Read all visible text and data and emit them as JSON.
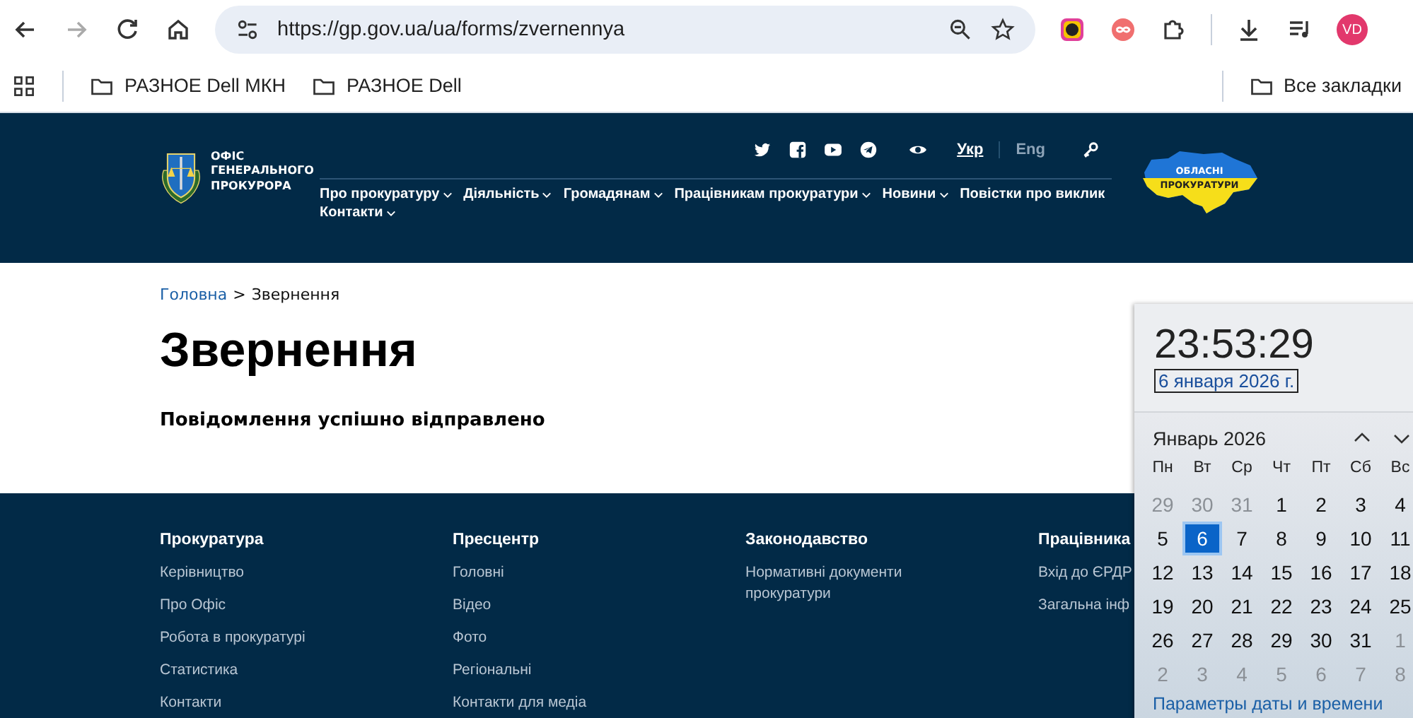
{
  "browser": {
    "url": "https://gp.gov.ua/ua/forms/zvernennya",
    "profile": "VD",
    "bookmarks": [
      {
        "label": "РАЗНОЕ Dell МКН"
      },
      {
        "label": "РАЗНОЕ Dell"
      }
    ],
    "all_bookmarks": "Все закладки"
  },
  "header": {
    "logo_text": "ОФІС ГЕНЕРАЛЬНОГО ПРОКУРОРА",
    "languages": [
      {
        "label": "Укр",
        "selected": true
      },
      {
        "label": "Eng",
        "selected": false
      }
    ],
    "nav": [
      {
        "label": "Про прокуратуру",
        "has_menu": true
      },
      {
        "label": "Діяльність",
        "has_menu": true
      },
      {
        "label": "Громадянам",
        "has_menu": true
      },
      {
        "label": "Працівникам прокуратури",
        "has_menu": true
      },
      {
        "label": "Новини",
        "has_menu": true
      },
      {
        "label": "Повістки про виклик",
        "has_menu": false
      },
      {
        "label": "Контакти",
        "has_menu": true
      }
    ],
    "map_badge": [
      "ОБЛАСНІ",
      "ПРОКУРАТУРИ"
    ]
  },
  "breadcrumb": [
    {
      "label": "Головна",
      "link": true
    },
    {
      "label": "Звернення",
      "link": false
    }
  ],
  "breadcrumb_separator": ">",
  "page": {
    "title": "Звернення",
    "message": "Повідомлення успішно відправлено"
  },
  "footer": [
    {
      "heading": "Прокуратура",
      "links": [
        "Керівництво",
        "Про Офіс",
        "Робота в прокуратурі",
        "Статистика",
        "Контакти"
      ]
    },
    {
      "heading": "Пресцентр",
      "links": [
        "Головні",
        "Відео",
        "Фото",
        "Регіональні",
        "Контакти для медіа"
      ]
    },
    {
      "heading": "Законодавство",
      "links": [
        "Нормативні документи прокуратури"
      ]
    },
    {
      "heading": "Працівника",
      "links": [
        "Вхід до ЄРДР",
        "Загальна інф"
      ]
    }
  ],
  "calendar": {
    "time": "23:53:29",
    "date": "6 января 2026 г.",
    "month": "Январь 2026",
    "weekdays": [
      "Пн",
      "Вт",
      "Ср",
      "Чт",
      "Пт",
      "Сб",
      "Вс"
    ],
    "days": [
      {
        "label": "29",
        "muted": true,
        "selected": false
      },
      {
        "label": "30",
        "muted": true,
        "selected": false
      },
      {
        "label": "31",
        "muted": true,
        "selected": false
      },
      {
        "label": "1",
        "muted": false,
        "selected": false
      },
      {
        "label": "2",
        "muted": false,
        "selected": false
      },
      {
        "label": "3",
        "muted": false,
        "selected": false
      },
      {
        "label": "4",
        "muted": false,
        "selected": false
      },
      {
        "label": "5",
        "muted": false,
        "selected": false
      },
      {
        "label": "6",
        "muted": false,
        "selected": true
      },
      {
        "label": "7",
        "muted": false,
        "selected": false
      },
      {
        "label": "8",
        "muted": false,
        "selected": false
      },
      {
        "label": "9",
        "muted": false,
        "selected": false
      },
      {
        "label": "10",
        "muted": false,
        "selected": false
      },
      {
        "label": "11",
        "muted": false,
        "selected": false
      },
      {
        "label": "12",
        "muted": false,
        "selected": false
      },
      {
        "label": "13",
        "muted": false,
        "selected": false
      },
      {
        "label": "14",
        "muted": false,
        "selected": false
      },
      {
        "label": "15",
        "muted": false,
        "selected": false
      },
      {
        "label": "16",
        "muted": false,
        "selected": false
      },
      {
        "label": "17",
        "muted": false,
        "selected": false
      },
      {
        "label": "18",
        "muted": false,
        "selected": false
      },
      {
        "label": "19",
        "muted": false,
        "selected": false
      },
      {
        "label": "20",
        "muted": false,
        "selected": false
      },
      {
        "label": "21",
        "muted": false,
        "selected": false
      },
      {
        "label": "22",
        "muted": false,
        "selected": false
      },
      {
        "label": "23",
        "muted": false,
        "selected": false
      },
      {
        "label": "24",
        "muted": false,
        "selected": false
      },
      {
        "label": "25",
        "muted": false,
        "selected": false
      },
      {
        "label": "26",
        "muted": false,
        "selected": false
      },
      {
        "label": "27",
        "muted": false,
        "selected": false
      },
      {
        "label": "28",
        "muted": false,
        "selected": false
      },
      {
        "label": "29",
        "muted": false,
        "selected": false
      },
      {
        "label": "30",
        "muted": false,
        "selected": false
      },
      {
        "label": "31",
        "muted": false,
        "selected": false
      },
      {
        "label": "1",
        "muted": true,
        "selected": false
      },
      {
        "label": "2",
        "muted": true,
        "selected": false
      },
      {
        "label": "3",
        "muted": true,
        "selected": false
      },
      {
        "label": "4",
        "muted": true,
        "selected": false
      },
      {
        "label": "5",
        "muted": true,
        "selected": false
      },
      {
        "label": "6",
        "muted": true,
        "selected": false
      },
      {
        "label": "7",
        "muted": true,
        "selected": false
      },
      {
        "label": "8",
        "muted": true,
        "selected": false
      }
    ],
    "settings_link": "Параметры даты и времени"
  }
}
